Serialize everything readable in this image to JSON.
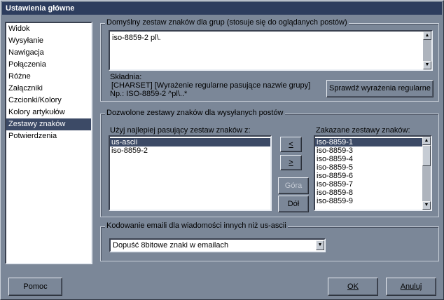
{
  "window": {
    "title": "Ustawienia główne"
  },
  "sidebar": {
    "items": [
      {
        "label": "Widok"
      },
      {
        "label": "Wysyłanie"
      },
      {
        "label": "Nawigacja"
      },
      {
        "label": "Połączenia"
      },
      {
        "label": "Różne"
      },
      {
        "label": "Załączniki"
      },
      {
        "label": "Czcionki/Kolory"
      },
      {
        "label": "Kolory artykułów"
      },
      {
        "label": "Zestawy znaków",
        "selected": true
      },
      {
        "label": "Potwierdzenia"
      }
    ]
  },
  "default_charset": {
    "group_title": "Domyślny zestaw znaków dla grup (stosuje się do oglądanych postów)",
    "value": "iso-8859-2 pl\\.",
    "syntax_title": "Składnia:",
    "syntax_line1": "[CHARSET] [Wyrażenie regularne pasujące nazwie grupy]",
    "syntax_line2": "Np.: ISO-8859-2 ^pl\\..*",
    "check_button": "Sprawdź wyrażenia regularne"
  },
  "allowed_charsets": {
    "group_title": "Dozwolone zestawy znaków dla wysyłanych postów",
    "best_label": "Użyj najlepiej pasujący zestaw znaków z:",
    "best_list": [
      "us-ascii",
      "iso-8859-2"
    ],
    "best_selected": 0,
    "forbidden_label": "Zakazane zestawy znaków:",
    "forbidden_list": [
      "iso-8859-1",
      "iso-8859-3",
      "iso-8859-4",
      "iso-8859-5",
      "iso-8859-6",
      "iso-8859-7",
      "iso-8859-8",
      "iso-8859-9"
    ],
    "forbidden_selected": 0,
    "move_left_button": "<",
    "move_right_button": ">",
    "up_button": "Góra",
    "down_button": "Dół"
  },
  "email_encoding": {
    "group_title": "Kodowanie emaili dla wiadomości innych niż us-ascii",
    "selected": "Dopuść 8bitowe znaki w emailach"
  },
  "footer": {
    "help": "Pomoc",
    "ok": "OK",
    "cancel": "Anuluj"
  }
}
